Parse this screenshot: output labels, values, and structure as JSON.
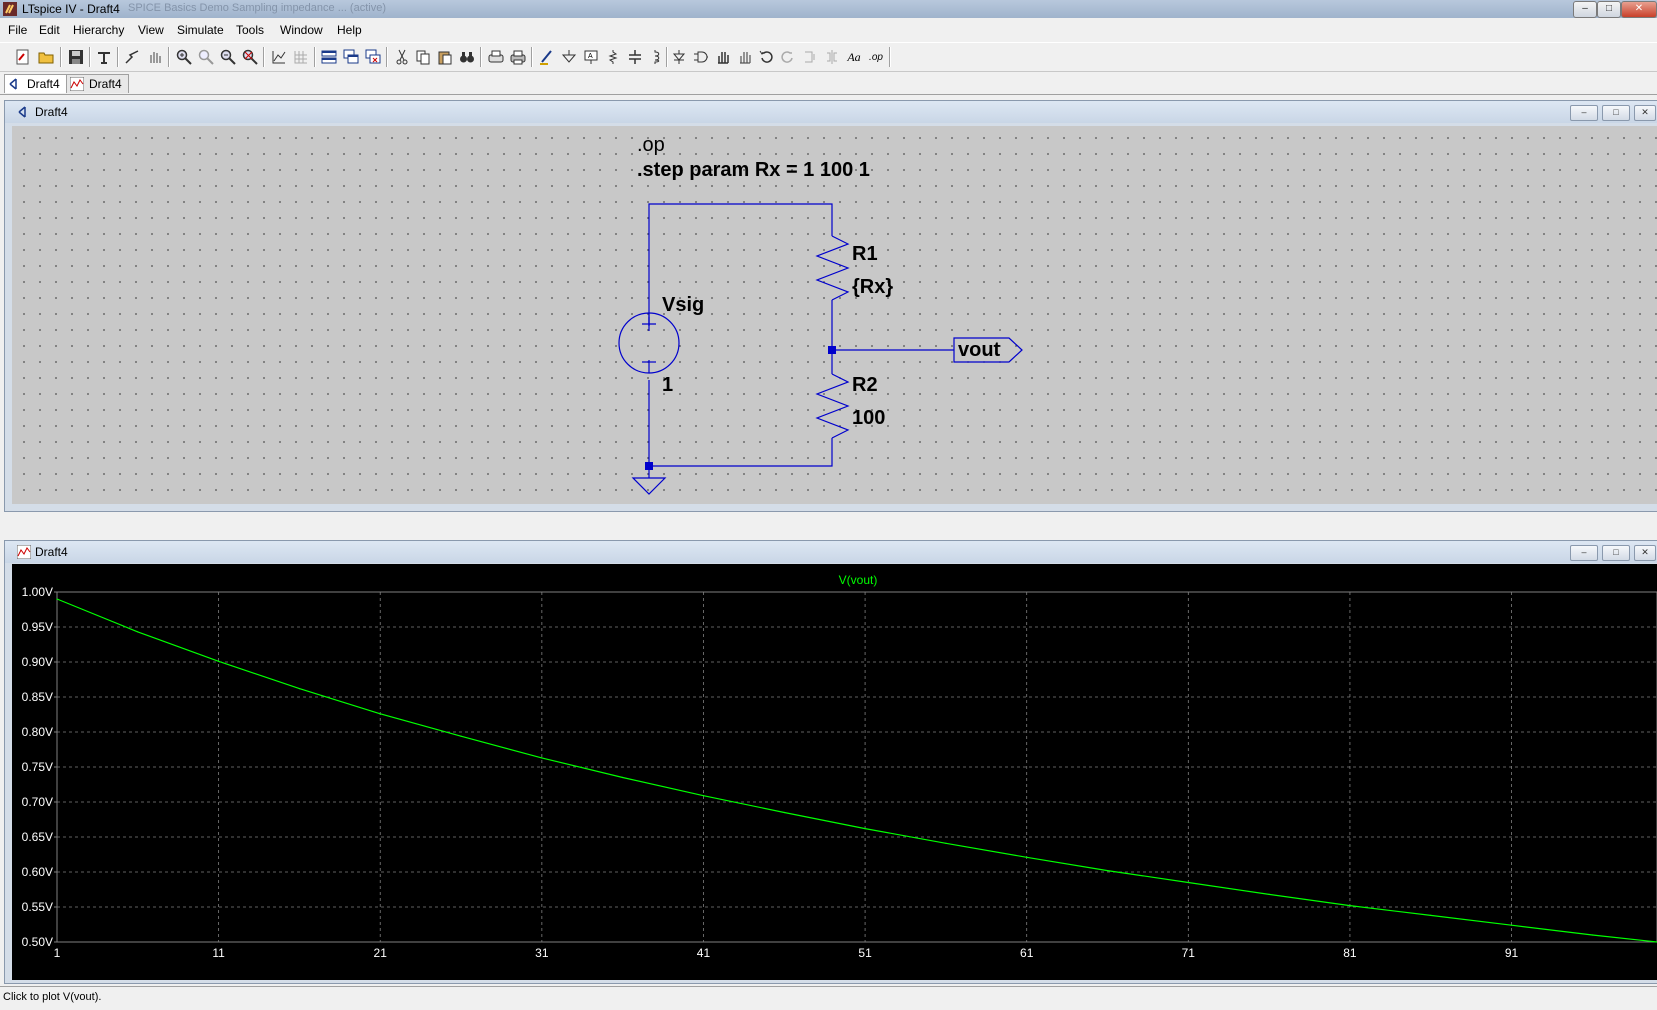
{
  "window": {
    "title": "LTspice IV - Draft4",
    "title_faded": "SPICE Basics Demo Sampling impedance ... (active)",
    "controls": [
      "minimize",
      "restore",
      "close"
    ]
  },
  "menu": [
    "File",
    "Edit",
    "Hierarchy",
    "View",
    "Simulate",
    "Tools",
    "Window",
    "Help"
  ],
  "toolbar_icons": [
    "new-schematic-icon",
    "open-icon",
    "save-icon",
    "control-panel-icon",
    "run-icon",
    "halt-icon",
    "zoom-in-icon",
    "zoom-back-icon",
    "zoom-out-icon",
    "zoom-fit-icon",
    "autorange-icon",
    "grid-icon",
    "tile-horizontal-icon",
    "cascade-icon",
    "close-all-icon",
    "cut-icon",
    "copy-icon",
    "paste-icon",
    "find-icon",
    "print-setup-icon",
    "print-icon",
    "draw-wire-icon",
    "ground-icon",
    "label-net-icon",
    "resistor-icon",
    "capacitor-icon",
    "inductor-icon",
    "diode-icon",
    "component-icon",
    "move-icon",
    "drag-icon",
    "undo-icon",
    "redo-icon",
    "rotate-icon",
    "mirror-icon",
    "text-icon",
    "spice-directive-icon"
  ],
  "toolbar_text": {
    "text_tool": "Aa",
    "op_tool": ".op"
  },
  "tabs": [
    {
      "label": "Draft4",
      "kind": "schematic",
      "active": true
    },
    {
      "label": "Draft4",
      "kind": "waveform",
      "active": false
    }
  ],
  "schematic": {
    "title": "Draft4",
    "directives": [
      ".op",
      ".step param Rx = 1 100 1"
    ],
    "source": {
      "name": "Vsig",
      "value": "1"
    },
    "r1": {
      "name": "R1",
      "value": "{Rx}"
    },
    "r2": {
      "name": "R2",
      "value": "100"
    },
    "net_label": "vout",
    "colors": {
      "wire": "#0000cc",
      "background": "#c8c8c8"
    }
  },
  "waveform": {
    "title": "Draft4",
    "trace_label": "V(vout)"
  },
  "chart_data": {
    "type": "line",
    "title": "V(vout)",
    "xlabel": "",
    "ylabel": "",
    "xlim": [
      1,
      100
    ],
    "ylim": [
      0.5,
      1.0
    ],
    "x_ticks": [
      "1",
      "11",
      "21",
      "31",
      "41",
      "51",
      "61",
      "71",
      "81",
      "91"
    ],
    "x_tick_values": [
      1,
      11,
      21,
      31,
      41,
      51,
      61,
      71,
      81,
      91
    ],
    "y_ticks": [
      "1.00V",
      "0.95V",
      "0.90V",
      "0.85V",
      "0.80V",
      "0.75V",
      "0.70V",
      "0.65V",
      "0.60V",
      "0.55V",
      "0.50V"
    ],
    "y_tick_values": [
      1.0,
      0.95,
      0.9,
      0.85,
      0.8,
      0.75,
      0.7,
      0.65,
      0.6,
      0.55,
      0.5
    ],
    "grid": true,
    "series": [
      {
        "name": "V(vout)",
        "color": "#00ff00",
        "x": [
          1,
          6,
          11,
          16,
          21,
          26,
          31,
          36,
          41,
          46,
          51,
          56,
          61,
          66,
          71,
          76,
          81,
          86,
          91,
          96,
          100
        ],
        "values": [
          0.99,
          0.943,
          0.901,
          0.862,
          0.826,
          0.794,
          0.763,
          0.735,
          0.709,
          0.685,
          0.662,
          0.641,
          0.621,
          0.602,
          0.585,
          0.568,
          0.552,
          0.538,
          0.524,
          0.51,
          0.5
        ]
      }
    ]
  },
  "status": "Click to plot V(vout)."
}
